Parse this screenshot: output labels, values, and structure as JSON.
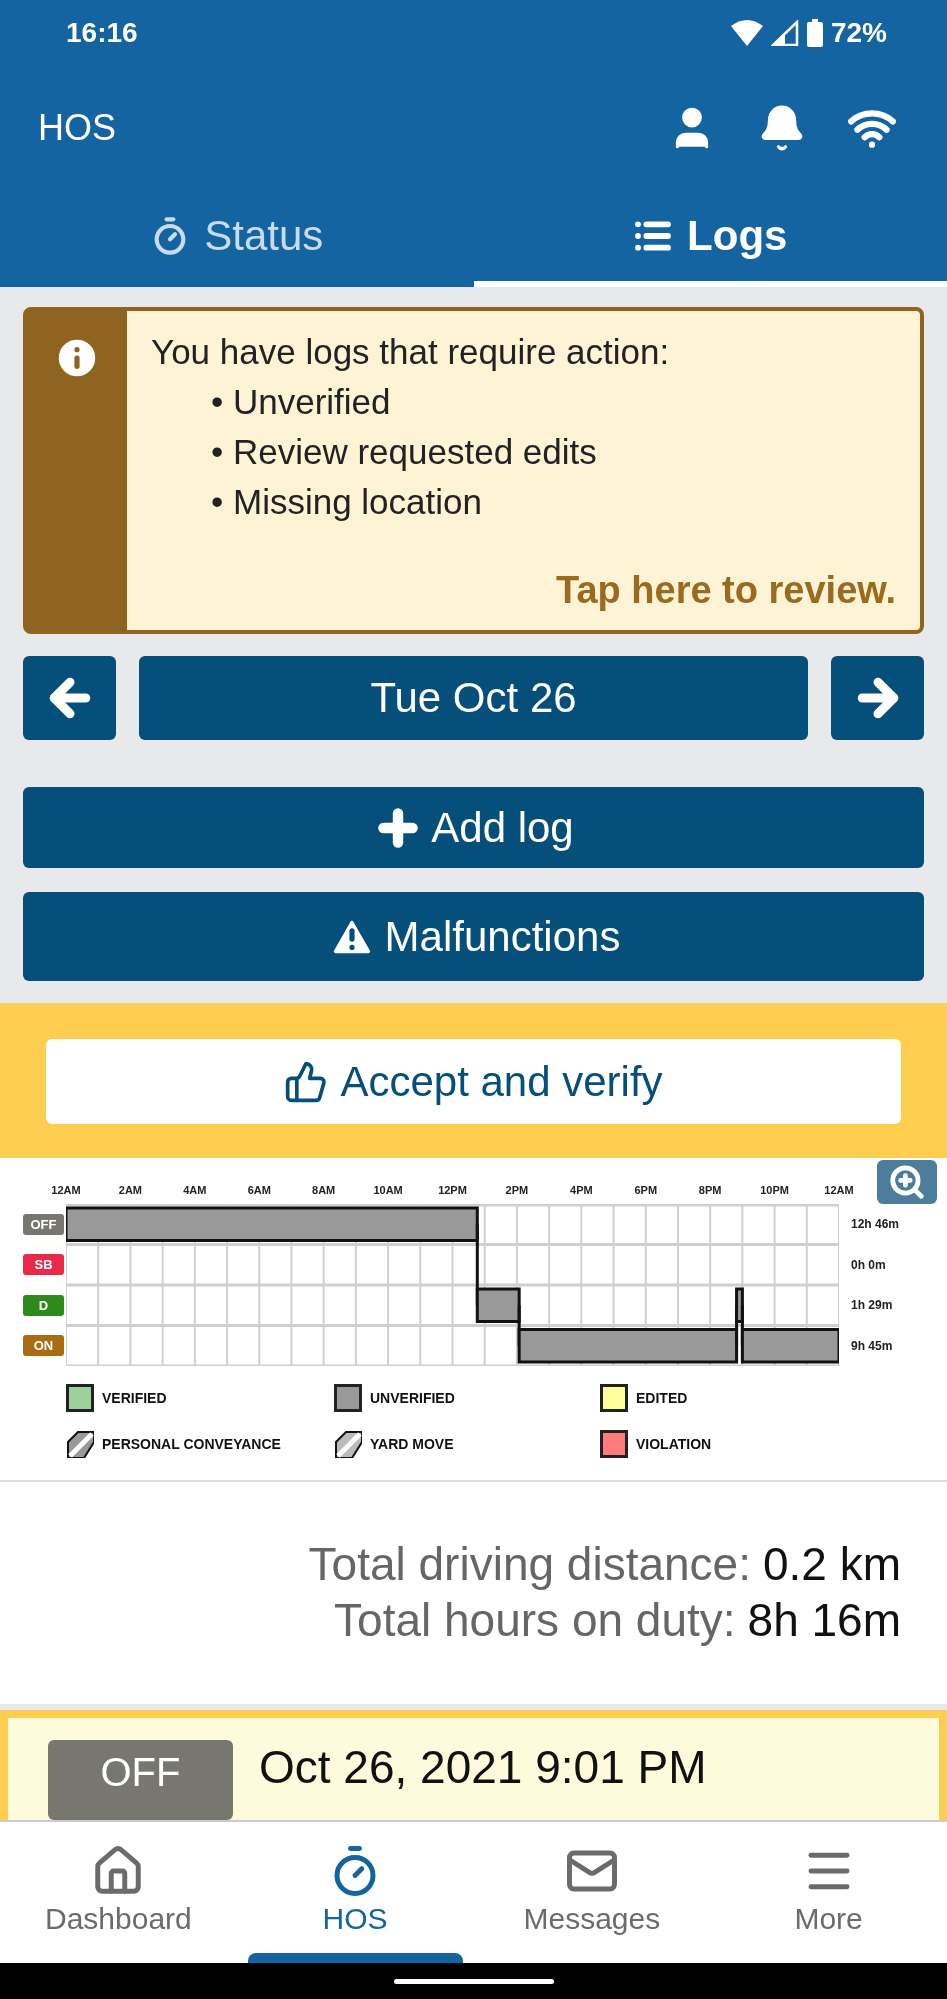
{
  "status_bar": {
    "time": "16:16",
    "battery": "72%"
  },
  "app_bar": {
    "title": "HOS"
  },
  "tabs": [
    {
      "label": "Status",
      "kind": "timer",
      "selected": false
    },
    {
      "label": "Logs",
      "kind": "list",
      "selected": true
    }
  ],
  "alert": {
    "title": "You have logs that require action:",
    "items": [
      "• Unverified",
      "• Review requested edits",
      "• Missing location"
    ],
    "link": "Tap here to review."
  },
  "date_nav": {
    "date": "Tue Oct 26"
  },
  "actions": [
    {
      "label": "Add log",
      "kind": "add"
    },
    {
      "label": "Malfunctions",
      "kind": "warning"
    }
  ],
  "verify_button": {
    "label": "Accept and verify"
  },
  "graph": {
    "hours": [
      "12AM",
      "2AM",
      "4AM",
      "6AM",
      "8AM",
      "10AM",
      "12PM",
      "2PM",
      "4PM",
      "6PM",
      "8PM",
      "10PM",
      "12AM"
    ],
    "rows": [
      {
        "status": "OFF",
        "color": "#77776f",
        "total": "12h 46m"
      },
      {
        "status": "SB",
        "color": "#e8294a",
        "total": "0h 0m"
      },
      {
        "status": "D",
        "color": "#2f8a1c",
        "total": "1h 29m"
      },
      {
        "status": "ON",
        "color": "#a86c12",
        "total": "9h 45m"
      }
    ],
    "legend": [
      {
        "label": "VERIFIED",
        "kind": "solid",
        "color": "#9bd09b"
      },
      {
        "label": "UNVERIFIED",
        "kind": "solid",
        "color": "#999999"
      },
      {
        "label": "EDITED",
        "kind": "solid",
        "color": "#ffff99"
      },
      {
        "label": "PERSONAL CONVEYANCE",
        "kind": "hatched",
        "color": "#999999"
      },
      {
        "label": "YARD MOVE",
        "kind": "hatched",
        "color": "#bbbbbb"
      },
      {
        "label": "VIOLATION",
        "kind": "solid",
        "color": "#ff7b7b"
      }
    ]
  },
  "totals": [
    {
      "label": "Total driving distance:",
      "value": "0.2 km"
    },
    {
      "label": "Total hours on duty:",
      "value": "8h 16m"
    }
  ],
  "event": {
    "status": "OFF",
    "time": "Oct 26, 2021 9:01 PM"
  },
  "bottom_nav": [
    {
      "label": "Dashboard",
      "kind": "home",
      "selected": false
    },
    {
      "label": "HOS",
      "kind": "timer",
      "selected": true
    },
    {
      "label": "Messages",
      "kind": "mail",
      "selected": false
    },
    {
      "label": "More",
      "kind": "menu",
      "selected": false
    }
  ]
}
